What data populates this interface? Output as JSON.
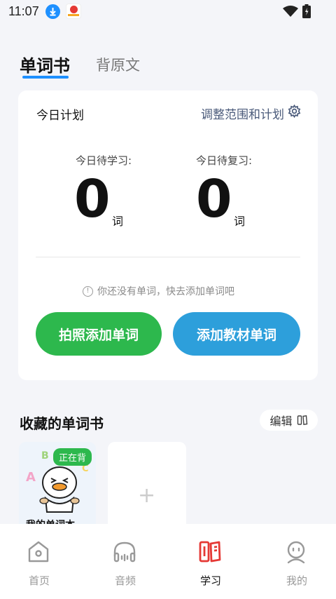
{
  "status_bar": {
    "time": "11:07"
  },
  "tabs": [
    {
      "label": "单词书",
      "active": true
    },
    {
      "label": "背原文",
      "active": false
    }
  ],
  "plan": {
    "title": "今日计划",
    "adjust_label": "调整范围和计划",
    "to_learn_label": "今日待学习:",
    "to_learn_count": "0",
    "to_review_label": "今日待复习:",
    "to_review_count": "0",
    "unit": "词",
    "empty_tip": "你还没有单词，快去添加单词吧",
    "photo_button": "拍照添加单词",
    "textbook_button": "添加教材单词"
  },
  "favorites": {
    "title": "收藏的单词书",
    "edit_label": "编辑",
    "books": [
      {
        "name": "我的单词本",
        "badge": "正在背"
      }
    ],
    "add_symbol": "+"
  },
  "bottom_nav": [
    {
      "label": "首页",
      "icon": "home-icon",
      "active": false
    },
    {
      "label": "音频",
      "icon": "headphones-icon",
      "active": false
    },
    {
      "label": "学习",
      "icon": "book-study-icon",
      "active": true
    },
    {
      "label": "我的",
      "icon": "profile-icon",
      "active": false
    }
  ],
  "colors": {
    "accent_blue": "#2d9fdb",
    "accent_green": "#2db84d",
    "active_nav": "#e53935",
    "background": "#f4f5f9"
  }
}
